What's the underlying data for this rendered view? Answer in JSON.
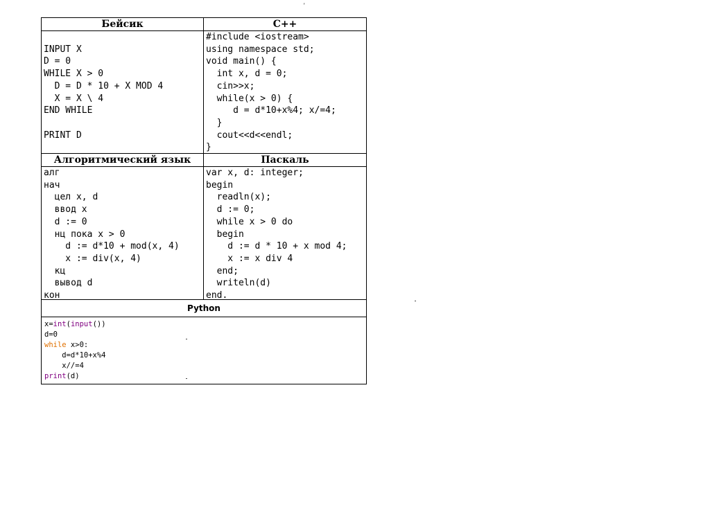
{
  "tick_mark": "'",
  "sections": {
    "basic": {
      "title": "Бейсик",
      "code": "\nINPUT X\nD = 0\nWHILE X > 0\n  D = D * 10 + X MOD 4\n  X = X \\ 4\nEND WHILE\n\nPRINT D"
    },
    "cpp": {
      "title": "C++",
      "code": "#include <iostream>\nusing namespace std;\nvoid main() {\n  int x, d = 0;\n  cin>>x;\n  while(x > 0) {\n     d = d*10+x%4; x/=4;\n  }\n  cout<<d<<endl;\n}"
    },
    "algo": {
      "title": "Алгоритмический язык",
      "code": "алг\nнач\n  цел x, d\n  ввод x\n  d := 0\n  нц пока x > 0\n    d := d*10 + mod(x, 4)\n    x := div(x, 4)\n  кц\n  вывод d\nкон"
    },
    "pascal": {
      "title": "Паскаль",
      "code": "var x, d: integer;\nbegin\n  readln(x);\n  d := 0;\n  while x > 0 do\n  begin\n    d := d * 10 + x mod 4;\n    x := x div 4\n  end;\n  writeln(d)\nend."
    },
    "python": {
      "title": "Python",
      "lines": [
        {
          "parts": [
            {
              "t": "x=",
              "c": ""
            },
            {
              "t": "int",
              "c": "fn"
            },
            {
              "t": "(",
              "c": ""
            },
            {
              "t": "input",
              "c": "fn"
            },
            {
              "t": "())",
              "c": ""
            }
          ]
        },
        {
          "parts": [
            {
              "t": "d=0",
              "c": ""
            }
          ]
        },
        {
          "parts": [
            {
              "t": "while",
              "c": "kw"
            },
            {
              "t": " x>0:",
              "c": ""
            }
          ]
        },
        {
          "parts": [
            {
              "t": "    d=d*10+x%4",
              "c": ""
            }
          ]
        },
        {
          "parts": [
            {
              "t": "    x//=4",
              "c": ""
            }
          ]
        },
        {
          "parts": [
            {
              "t": "print",
              "c": "fn"
            },
            {
              "t": "(d)",
              "c": ""
            }
          ]
        }
      ]
    }
  },
  "colors": {
    "keyword": "#e07000",
    "builtin": "#800080"
  }
}
